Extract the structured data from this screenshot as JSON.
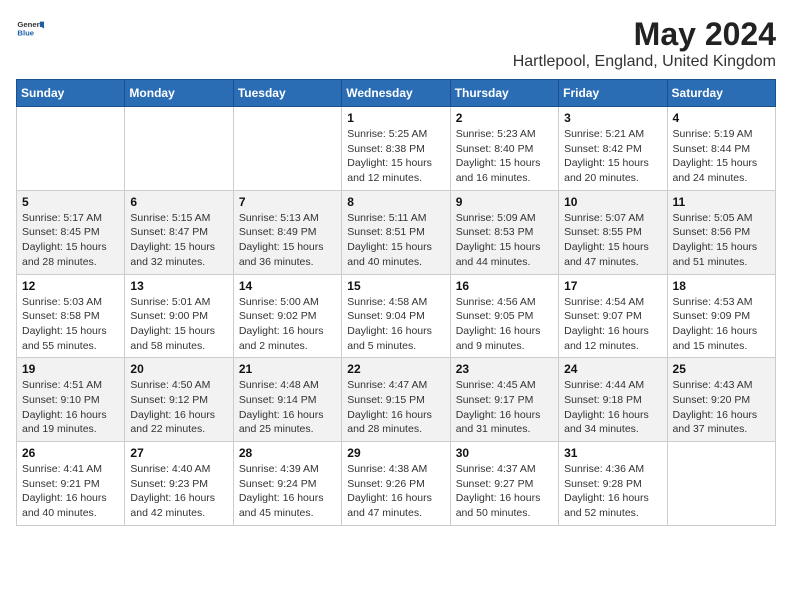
{
  "logo": {
    "general": "General",
    "blue": "Blue"
  },
  "title": "May 2024",
  "subtitle": "Hartlepool, England, United Kingdom",
  "headers": [
    "Sunday",
    "Monday",
    "Tuesday",
    "Wednesday",
    "Thursday",
    "Friday",
    "Saturday"
  ],
  "weeks": [
    [
      {
        "day": "",
        "detail": ""
      },
      {
        "day": "",
        "detail": ""
      },
      {
        "day": "",
        "detail": ""
      },
      {
        "day": "1",
        "detail": "Sunrise: 5:25 AM\nSunset: 8:38 PM\nDaylight: 15 hours\nand 12 minutes."
      },
      {
        "day": "2",
        "detail": "Sunrise: 5:23 AM\nSunset: 8:40 PM\nDaylight: 15 hours\nand 16 minutes."
      },
      {
        "day": "3",
        "detail": "Sunrise: 5:21 AM\nSunset: 8:42 PM\nDaylight: 15 hours\nand 20 minutes."
      },
      {
        "day": "4",
        "detail": "Sunrise: 5:19 AM\nSunset: 8:44 PM\nDaylight: 15 hours\nand 24 minutes."
      }
    ],
    [
      {
        "day": "5",
        "detail": "Sunrise: 5:17 AM\nSunset: 8:45 PM\nDaylight: 15 hours\nand 28 minutes."
      },
      {
        "day": "6",
        "detail": "Sunrise: 5:15 AM\nSunset: 8:47 PM\nDaylight: 15 hours\nand 32 minutes."
      },
      {
        "day": "7",
        "detail": "Sunrise: 5:13 AM\nSunset: 8:49 PM\nDaylight: 15 hours\nand 36 minutes."
      },
      {
        "day": "8",
        "detail": "Sunrise: 5:11 AM\nSunset: 8:51 PM\nDaylight: 15 hours\nand 40 minutes."
      },
      {
        "day": "9",
        "detail": "Sunrise: 5:09 AM\nSunset: 8:53 PM\nDaylight: 15 hours\nand 44 minutes."
      },
      {
        "day": "10",
        "detail": "Sunrise: 5:07 AM\nSunset: 8:55 PM\nDaylight: 15 hours\nand 47 minutes."
      },
      {
        "day": "11",
        "detail": "Sunrise: 5:05 AM\nSunset: 8:56 PM\nDaylight: 15 hours\nand 51 minutes."
      }
    ],
    [
      {
        "day": "12",
        "detail": "Sunrise: 5:03 AM\nSunset: 8:58 PM\nDaylight: 15 hours\nand 55 minutes."
      },
      {
        "day": "13",
        "detail": "Sunrise: 5:01 AM\nSunset: 9:00 PM\nDaylight: 15 hours\nand 58 minutes."
      },
      {
        "day": "14",
        "detail": "Sunrise: 5:00 AM\nSunset: 9:02 PM\nDaylight: 16 hours\nand 2 minutes."
      },
      {
        "day": "15",
        "detail": "Sunrise: 4:58 AM\nSunset: 9:04 PM\nDaylight: 16 hours\nand 5 minutes."
      },
      {
        "day": "16",
        "detail": "Sunrise: 4:56 AM\nSunset: 9:05 PM\nDaylight: 16 hours\nand 9 minutes."
      },
      {
        "day": "17",
        "detail": "Sunrise: 4:54 AM\nSunset: 9:07 PM\nDaylight: 16 hours\nand 12 minutes."
      },
      {
        "day": "18",
        "detail": "Sunrise: 4:53 AM\nSunset: 9:09 PM\nDaylight: 16 hours\nand 15 minutes."
      }
    ],
    [
      {
        "day": "19",
        "detail": "Sunrise: 4:51 AM\nSunset: 9:10 PM\nDaylight: 16 hours\nand 19 minutes."
      },
      {
        "day": "20",
        "detail": "Sunrise: 4:50 AM\nSunset: 9:12 PM\nDaylight: 16 hours\nand 22 minutes."
      },
      {
        "day": "21",
        "detail": "Sunrise: 4:48 AM\nSunset: 9:14 PM\nDaylight: 16 hours\nand 25 minutes."
      },
      {
        "day": "22",
        "detail": "Sunrise: 4:47 AM\nSunset: 9:15 PM\nDaylight: 16 hours\nand 28 minutes."
      },
      {
        "day": "23",
        "detail": "Sunrise: 4:45 AM\nSunset: 9:17 PM\nDaylight: 16 hours\nand 31 minutes."
      },
      {
        "day": "24",
        "detail": "Sunrise: 4:44 AM\nSunset: 9:18 PM\nDaylight: 16 hours\nand 34 minutes."
      },
      {
        "day": "25",
        "detail": "Sunrise: 4:43 AM\nSunset: 9:20 PM\nDaylight: 16 hours\nand 37 minutes."
      }
    ],
    [
      {
        "day": "26",
        "detail": "Sunrise: 4:41 AM\nSunset: 9:21 PM\nDaylight: 16 hours\nand 40 minutes."
      },
      {
        "day": "27",
        "detail": "Sunrise: 4:40 AM\nSunset: 9:23 PM\nDaylight: 16 hours\nand 42 minutes."
      },
      {
        "day": "28",
        "detail": "Sunrise: 4:39 AM\nSunset: 9:24 PM\nDaylight: 16 hours\nand 45 minutes."
      },
      {
        "day": "29",
        "detail": "Sunrise: 4:38 AM\nSunset: 9:26 PM\nDaylight: 16 hours\nand 47 minutes."
      },
      {
        "day": "30",
        "detail": "Sunrise: 4:37 AM\nSunset: 9:27 PM\nDaylight: 16 hours\nand 50 minutes."
      },
      {
        "day": "31",
        "detail": "Sunrise: 4:36 AM\nSunset: 9:28 PM\nDaylight: 16 hours\nand 52 minutes."
      },
      {
        "day": "",
        "detail": ""
      }
    ]
  ]
}
